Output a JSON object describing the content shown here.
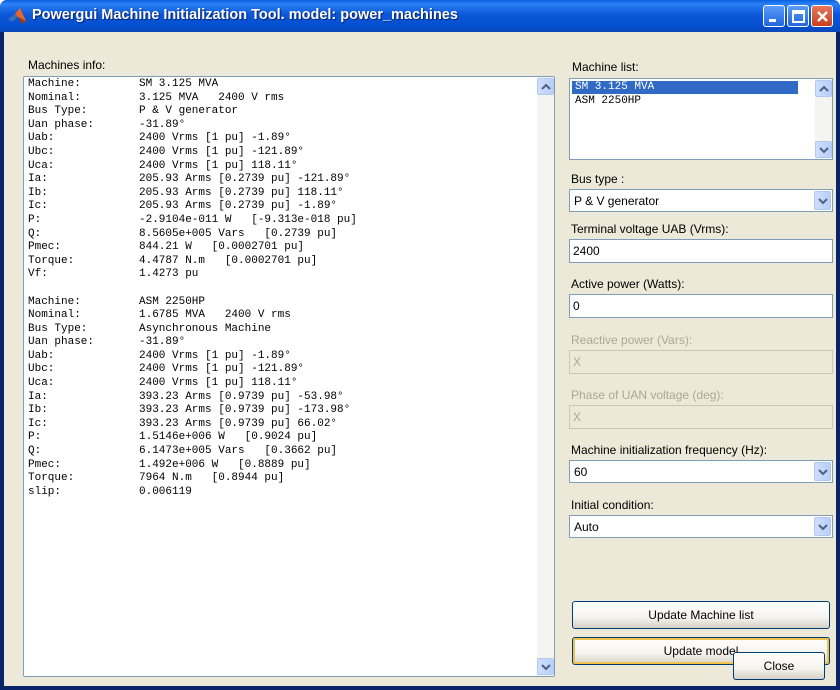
{
  "window": {
    "title": "Powergui Machine Initialization Tool.  model: power_machines"
  },
  "machines_info": {
    "label": "Machines info:",
    "lines": [
      {
        "k": "Machine:",
        "v": "SM 3.125 MVA"
      },
      {
        "k": "Nominal:",
        "v": "3.125 MVA   2400 V rms"
      },
      {
        "k": "Bus Type:",
        "v": "P & V generator"
      },
      {
        "k": "Uan phase:",
        "v": "-31.89°"
      },
      {
        "k": "Uab:",
        "v": "2400 Vrms [1 pu] -1.89°"
      },
      {
        "k": "Ubc:",
        "v": "2400 Vrms [1 pu] -121.89°"
      },
      {
        "k": "Uca:",
        "v": "2400 Vrms [1 pu] 118.11°"
      },
      {
        "k": "Ia:",
        "v": "205.93 Arms [0.2739 pu] -121.89°"
      },
      {
        "k": "Ib:",
        "v": "205.93 Arms [0.2739 pu] 118.11°"
      },
      {
        "k": "Ic:",
        "v": "205.93 Arms [0.2739 pu] -1.89°"
      },
      {
        "k": "P:",
        "v": "-2.9104e-011 W   [-9.313e-018 pu]"
      },
      {
        "k": "Q:",
        "v": "8.5605e+005 Vars   [0.2739 pu]"
      },
      {
        "k": "Pmec:",
        "v": "844.21 W   [0.0002701 pu]"
      },
      {
        "k": "Torque:",
        "v": "4.4787 N.m   [0.0002701 pu]"
      },
      {
        "k": "Vf:",
        "v": "1.4273 pu"
      },
      {
        "k": "",
        "v": ""
      },
      {
        "k": "Machine:",
        "v": "ASM 2250HP"
      },
      {
        "k": "Nominal:",
        "v": "1.6785 MVA   2400 V rms"
      },
      {
        "k": "Bus Type:",
        "v": "Asynchronous Machine"
      },
      {
        "k": "Uan phase:",
        "v": "-31.89°"
      },
      {
        "k": "Uab:",
        "v": "2400 Vrms [1 pu] -1.89°"
      },
      {
        "k": "Ubc:",
        "v": "2400 Vrms [1 pu] -121.89°"
      },
      {
        "k": "Uca:",
        "v": "2400 Vrms [1 pu] 118.11°"
      },
      {
        "k": "Ia:",
        "v": "393.23 Arms [0.9739 pu] -53.98°"
      },
      {
        "k": "Ib:",
        "v": "393.23 Arms [0.9739 pu] -173.98°"
      },
      {
        "k": "Ic:",
        "v": "393.23 Arms [0.9739 pu] 66.02°"
      },
      {
        "k": "P:",
        "v": "1.5146e+006 W   [0.9024 pu]"
      },
      {
        "k": "Q:",
        "v": "6.1473e+005 Vars   [0.3662 pu]"
      },
      {
        "k": "Pmec:",
        "v": "1.492e+006 W   [0.8889 pu]"
      },
      {
        "k": "Torque:",
        "v": "7964 N.m   [0.8944 pu]"
      },
      {
        "k": "slip:",
        "v": "0.006119"
      }
    ]
  },
  "machine_list": {
    "label": "Machine list:",
    "items": [
      "SM 3.125 MVA",
      "ASM 2250HP"
    ],
    "selected": "SM 3.125 MVA"
  },
  "bus_type": {
    "label": "Bus type :",
    "value": "P & V generator"
  },
  "terminal_voltage": {
    "label": "Terminal voltage UAB (Vrms):",
    "value": "2400"
  },
  "active_power": {
    "label": "Active power (Watts):",
    "value": "0"
  },
  "reactive_power": {
    "label": "Reactive power (Vars):",
    "value": "X"
  },
  "phase_uan": {
    "label": "Phase of UAN voltage (deg):",
    "value": "X"
  },
  "init_frequency": {
    "label": "Machine initialization frequency (Hz):",
    "value": "60"
  },
  "initial_condition": {
    "label": "Initial condition:",
    "value": "Auto"
  },
  "buttons": {
    "update_list": "Update Machine list",
    "update_model": "Update model",
    "close": "Close"
  },
  "colors": {
    "titlebar": "#0054e3",
    "selection": "#316ac5",
    "dialog_bg": "#ece9d8"
  }
}
